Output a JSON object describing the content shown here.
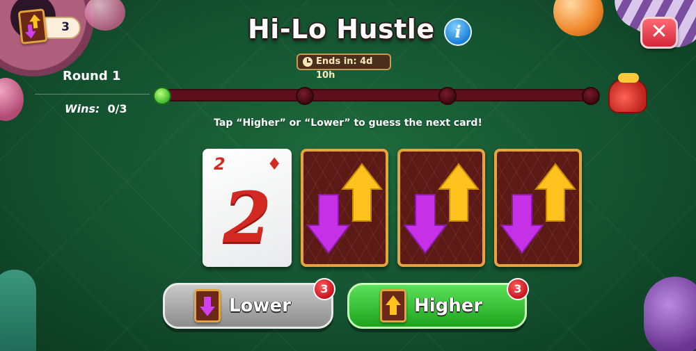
{
  "header": {
    "title": "Hi-Lo Hustle",
    "info_icon": "info-icon",
    "close_icon": "close-icon",
    "timer_text": "Ends in: 4d 10h"
  },
  "counter": {
    "value": "3",
    "icon": "swap-card-icon"
  },
  "round": {
    "label": "Round 1",
    "wins_label": "Wins:",
    "wins_value": "0/3"
  },
  "progress": {
    "completed_nodes": 1,
    "total_nodes": 4,
    "reward_icon": "gift-icon"
  },
  "instruction": "Tap “Higher” or “Lower” to guess the next card!",
  "cards": {
    "revealed": {
      "rank": "2",
      "suit": "♦"
    },
    "hidden_count": 3
  },
  "buttons": {
    "lower": {
      "label": "Lower",
      "badge": "3"
    },
    "higher": {
      "label": "Higher",
      "badge": "3"
    }
  },
  "colors": {
    "felt": "#1f6a3c",
    "card_red": "#d22a23",
    "arrow_up": "#ffc21f",
    "arrow_down": "#c630e6"
  }
}
